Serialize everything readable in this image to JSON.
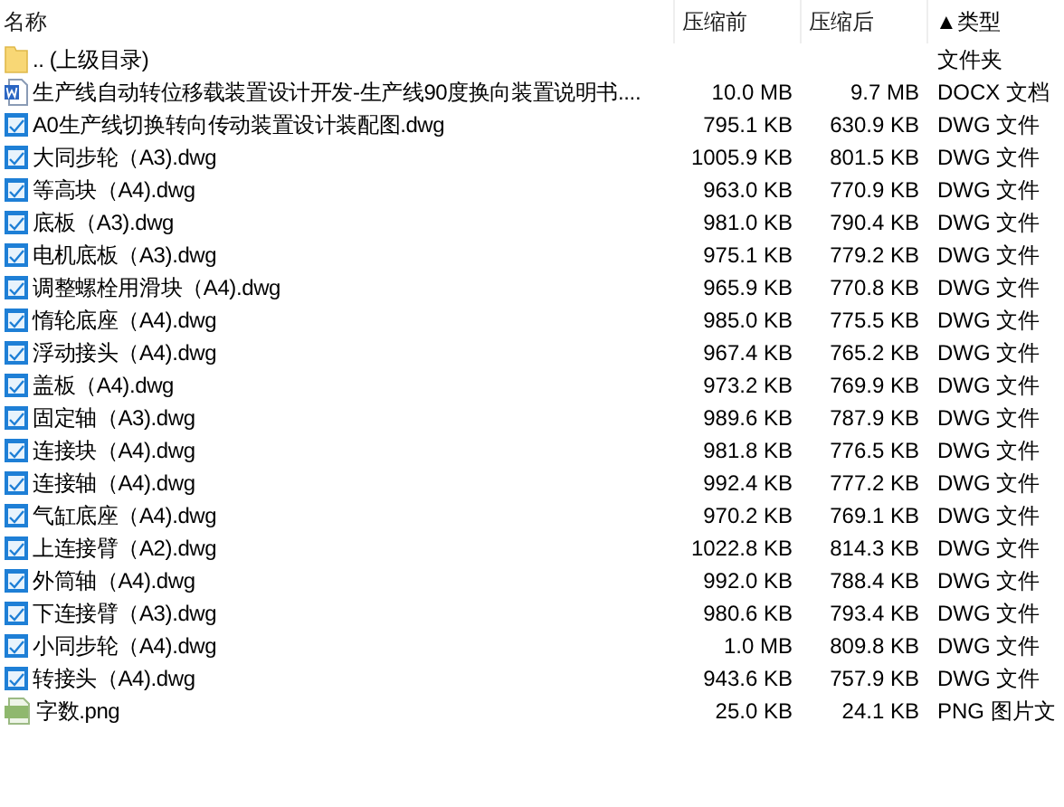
{
  "columns": [
    {
      "label": "名称"
    },
    {
      "label": "压缩前"
    },
    {
      "label": "压缩后"
    },
    {
      "label": "类型",
      "sort_mark": "▲"
    }
  ],
  "rows": [
    {
      "kind": "folder",
      "name": ".. (上级目录)",
      "type": "文件夹"
    },
    {
      "kind": "docx",
      "name": "生产线自动转位移载装置设计开发-生产线90度换向装置说明书....",
      "before": "10.0 MB",
      "after": "9.7 MB",
      "type": "DOCX 文档"
    },
    {
      "kind": "dwg",
      "name": "A0生产线切换转向传动装置设计装配图.dwg",
      "before": "795.1 KB",
      "after": "630.9 KB",
      "type": "DWG 文件"
    },
    {
      "kind": "dwg",
      "name": "大同步轮（A3).dwg",
      "before": "1005.9 KB",
      "after": "801.5 KB",
      "type": "DWG 文件"
    },
    {
      "kind": "dwg",
      "name": "等高块（A4).dwg",
      "before": "963.0 KB",
      "after": "770.9 KB",
      "type": "DWG 文件"
    },
    {
      "kind": "dwg",
      "name": "底板（A3).dwg",
      "before": "981.0 KB",
      "after": "790.4 KB",
      "type": "DWG 文件"
    },
    {
      "kind": "dwg",
      "name": "电机底板（A3).dwg",
      "before": "975.1 KB",
      "after": "779.2 KB",
      "type": "DWG 文件"
    },
    {
      "kind": "dwg",
      "name": "调整螺栓用滑块（A4).dwg",
      "before": "965.9 KB",
      "after": "770.8 KB",
      "type": "DWG 文件"
    },
    {
      "kind": "dwg",
      "name": "惰轮底座（A4).dwg",
      "before": "985.0 KB",
      "after": "775.5 KB",
      "type": "DWG 文件"
    },
    {
      "kind": "dwg",
      "name": "浮动接头（A4).dwg",
      "before": "967.4 KB",
      "after": "765.2 KB",
      "type": "DWG 文件"
    },
    {
      "kind": "dwg",
      "name": "盖板（A4).dwg",
      "before": "973.2 KB",
      "after": "769.9 KB",
      "type": "DWG 文件"
    },
    {
      "kind": "dwg",
      "name": "固定轴（A3).dwg",
      "before": "989.6 KB",
      "after": "787.9 KB",
      "type": "DWG 文件"
    },
    {
      "kind": "dwg",
      "name": "连接块（A4).dwg",
      "before": "981.8 KB",
      "after": "776.5 KB",
      "type": "DWG 文件"
    },
    {
      "kind": "dwg",
      "name": "连接轴（A4).dwg",
      "before": "992.4 KB",
      "after": "777.2 KB",
      "type": "DWG 文件"
    },
    {
      "kind": "dwg",
      "name": "气缸底座（A4).dwg",
      "before": "970.2 KB",
      "after": "769.1 KB",
      "type": "DWG 文件"
    },
    {
      "kind": "dwg",
      "name": "上连接臂（A2).dwg",
      "before": "1022.8 KB",
      "after": "814.3 KB",
      "type": "DWG 文件"
    },
    {
      "kind": "dwg",
      "name": "外筒轴（A4).dwg",
      "before": "992.0 KB",
      "after": "788.4 KB",
      "type": "DWG 文件"
    },
    {
      "kind": "dwg",
      "name": "下连接臂（A3).dwg",
      "before": "980.6 KB",
      "after": "793.4 KB",
      "type": "DWG 文件"
    },
    {
      "kind": "dwg",
      "name": "小同步轮（A4).dwg",
      "before": "1.0 MB",
      "after": "809.8 KB",
      "type": "DWG 文件"
    },
    {
      "kind": "dwg",
      "name": "转接头（A4).dwg",
      "before": "943.6 KB",
      "after": "757.9 KB",
      "type": "DWG 文件"
    },
    {
      "kind": "png",
      "name": "字数.png",
      "before": "25.0 KB",
      "after": "24.1 KB",
      "type": "PNG 图片文"
    }
  ]
}
